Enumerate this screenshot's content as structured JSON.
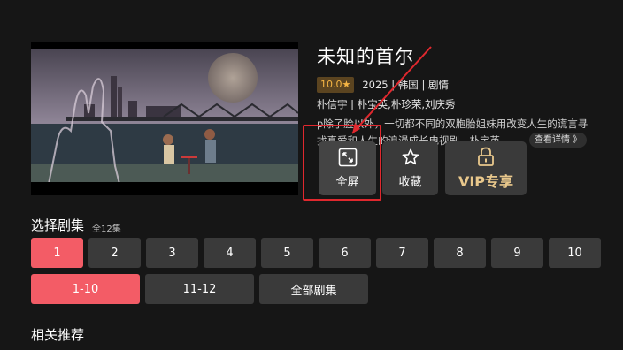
{
  "show": {
    "title": "未知的首尔",
    "score": "10.0★",
    "meta": "2025 | 韩国 | 剧情",
    "cast": "朴信宇 | 朴宝英,朴珍荣,刘庆秀",
    "description": "p除了脸以外，一切都不同的双胞胎姐妹用改变人生的谎言寻找真爱和人生的浪漫成长电视剧。朴宝英",
    "more_label": "查看详情 》"
  },
  "actions": {
    "fullscreen": "全屏",
    "favorite": "收藏",
    "vip": "VIP专享"
  },
  "episodes": {
    "title": "选择剧集",
    "count": "全12集",
    "items": [
      "1",
      "2",
      "3",
      "4",
      "5",
      "6",
      "7",
      "8",
      "9",
      "10"
    ],
    "ranges": [
      "1-10",
      "11-12",
      "全部剧集"
    ]
  },
  "related_title": "相关推荐",
  "colors": {
    "accent": "#f35c66",
    "highlight": "#e0282e",
    "vip_gold": "#e9c88c",
    "score_gold": "#f5b544"
  }
}
